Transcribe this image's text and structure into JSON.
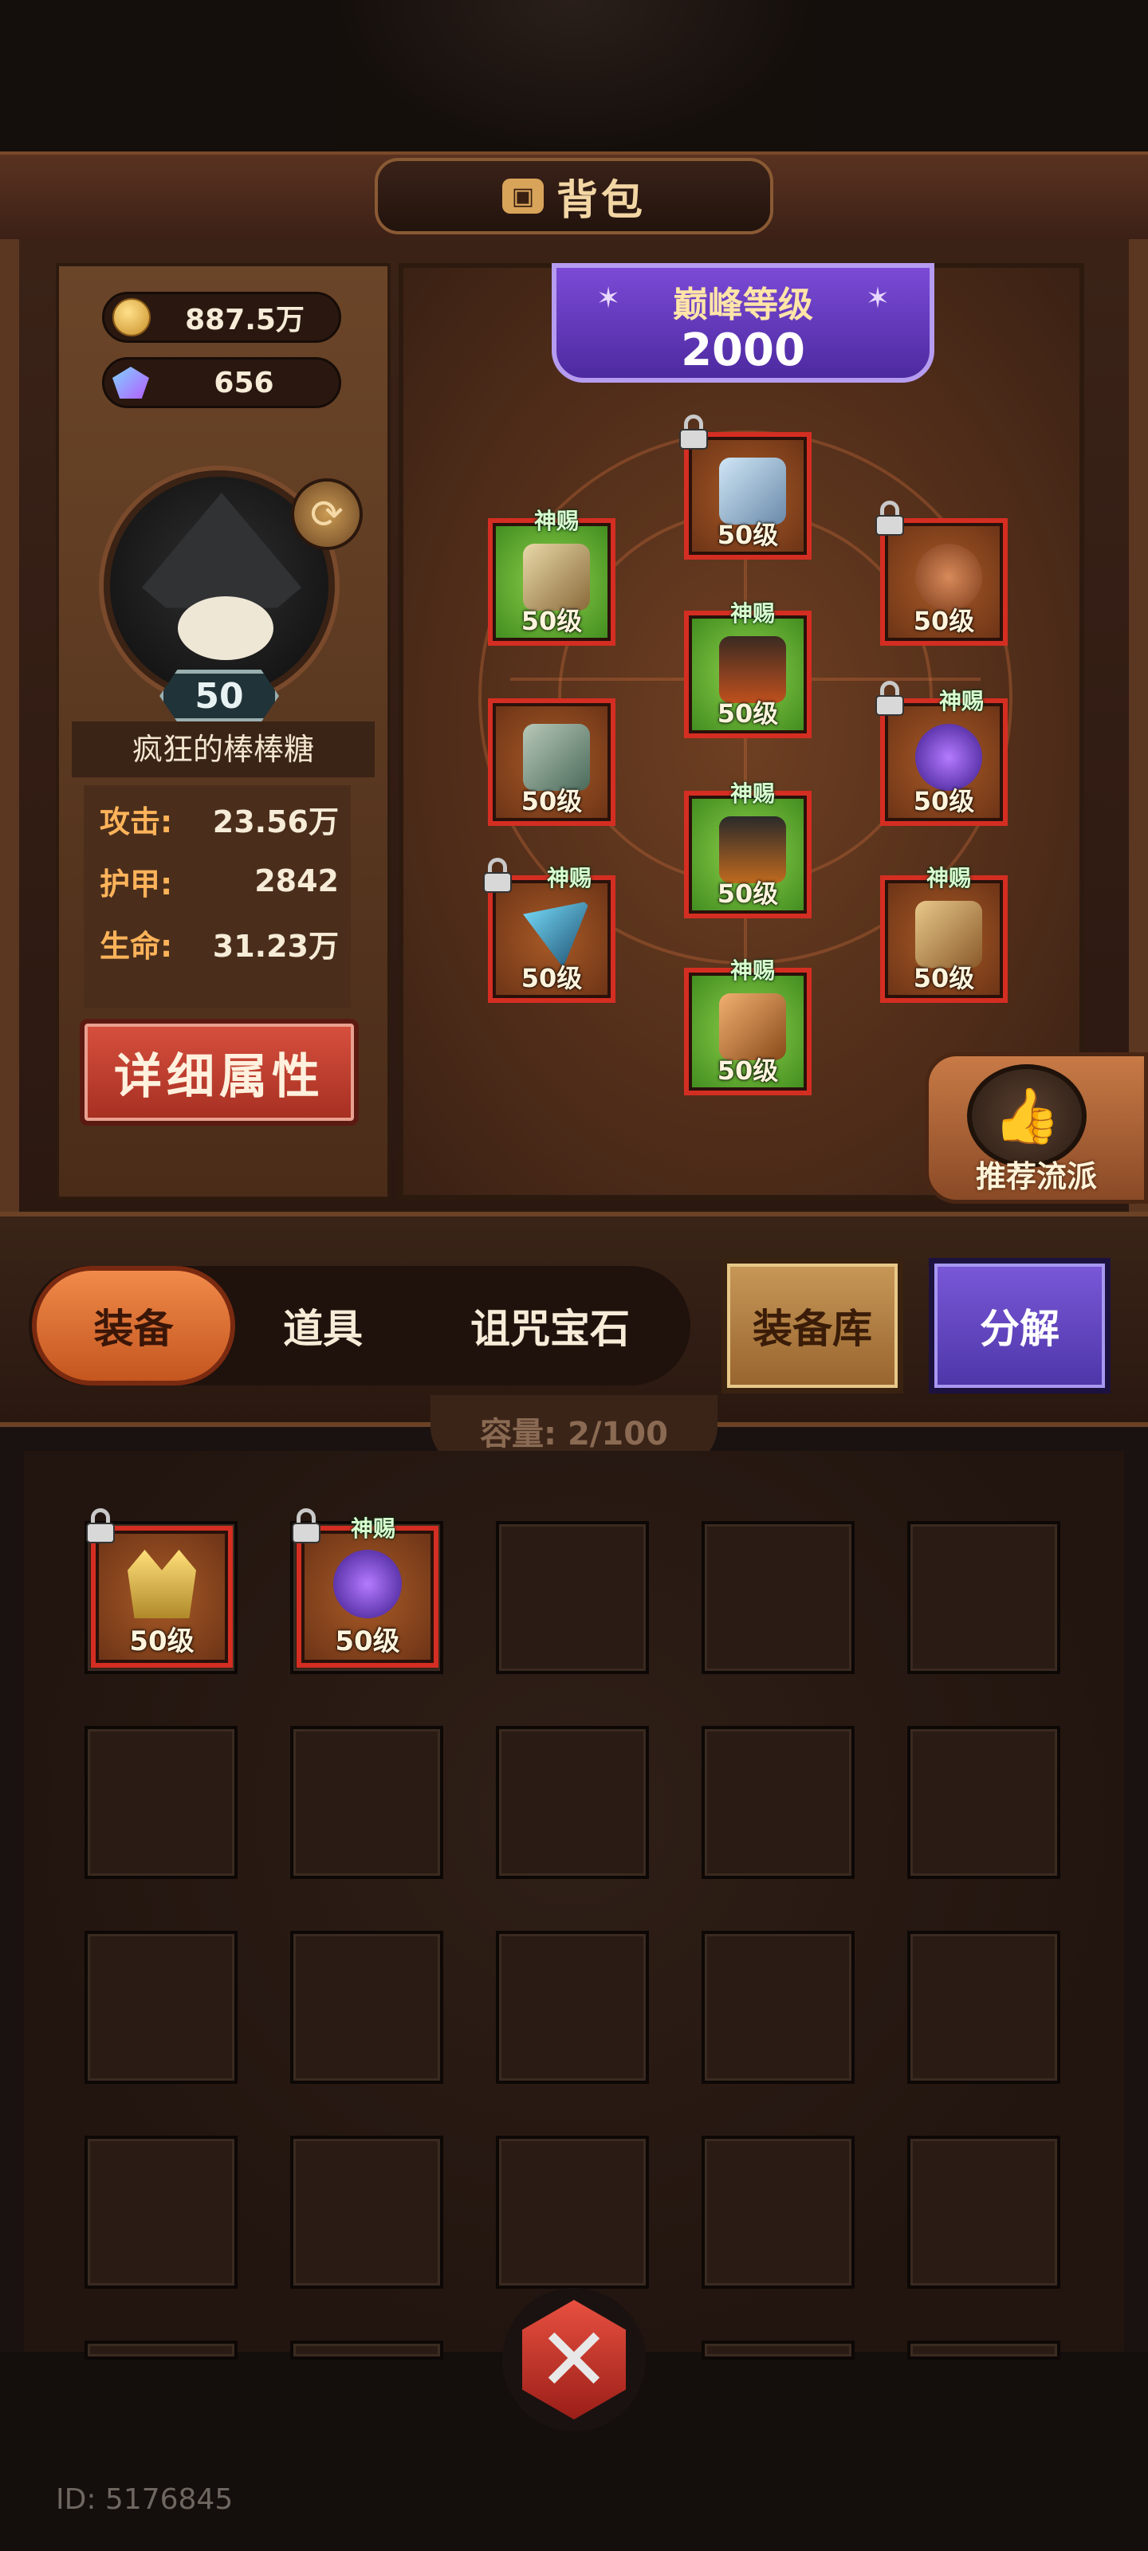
{
  "header": {
    "title": "背包"
  },
  "currency": {
    "gold": "887.5万",
    "gems": "656"
  },
  "player": {
    "level": "50",
    "name": "疯狂的棒棒糖",
    "stats": [
      {
        "label": "攻击:",
        "value": "23.56万"
      },
      {
        "label": "护甲:",
        "value": "2842"
      },
      {
        "label": "生命:",
        "value": "31.23万"
      }
    ],
    "detail_button": "详细属性"
  },
  "peak": {
    "title": "巅峰等级",
    "value": "2000"
  },
  "equipment": {
    "tag": "神赐",
    "level_text": "50级",
    "slots": [
      {
        "name": "helmet",
        "color": "orange",
        "locked": true,
        "blessed": false,
        "icon": "wizard-hat-icon"
      },
      {
        "name": "shoulder",
        "color": "green",
        "locked": false,
        "blessed": true,
        "icon": "shoulder-armor-icon"
      },
      {
        "name": "necklace",
        "color": "orange",
        "locked": true,
        "blessed": false,
        "icon": "necklace-icon"
      },
      {
        "name": "chest",
        "color": "green",
        "locked": false,
        "blessed": true,
        "icon": "cloak-icon"
      },
      {
        "name": "gloves",
        "color": "orange",
        "locked": false,
        "blessed": false,
        "icon": "gauntlet-icon"
      },
      {
        "name": "ring",
        "color": "orange",
        "locked": true,
        "blessed": true,
        "icon": "ring-icon"
      },
      {
        "name": "pants",
        "color": "green",
        "locked": false,
        "blessed": true,
        "icon": "pants-icon"
      },
      {
        "name": "weapon",
        "color": "orange",
        "locked": true,
        "blessed": true,
        "icon": "claw-weapon-icon"
      },
      {
        "name": "bracer",
        "color": "orange",
        "locked": false,
        "blessed": true,
        "icon": "bracer-icon"
      },
      {
        "name": "boots",
        "color": "green",
        "locked": false,
        "blessed": true,
        "icon": "boots-icon"
      }
    ]
  },
  "recommend": {
    "label": "推荐流派"
  },
  "tabs": [
    {
      "label": "装备",
      "active": true
    },
    {
      "label": "道具",
      "active": false
    },
    {
      "label": "诅咒宝石",
      "active": false
    }
  ],
  "buttons": {
    "armory": "装备库",
    "decompose": "分解"
  },
  "inventory": {
    "capacity": "容量: 2/100",
    "items": [
      {
        "icon": "crown-icon",
        "level": "50级",
        "locked": true,
        "blessed": false
      },
      {
        "icon": "amulet-icon",
        "level": "50级",
        "locked": true,
        "blessed": true,
        "tag": "神赐"
      }
    ]
  },
  "footer": {
    "user_id": "ID: 5176845"
  },
  "colors": {
    "rarity_red": "#d42e22",
    "blessed_green": "#6cbf3a",
    "peak_purple": "#6a3ec6",
    "accent_orange": "#e07a3a"
  }
}
